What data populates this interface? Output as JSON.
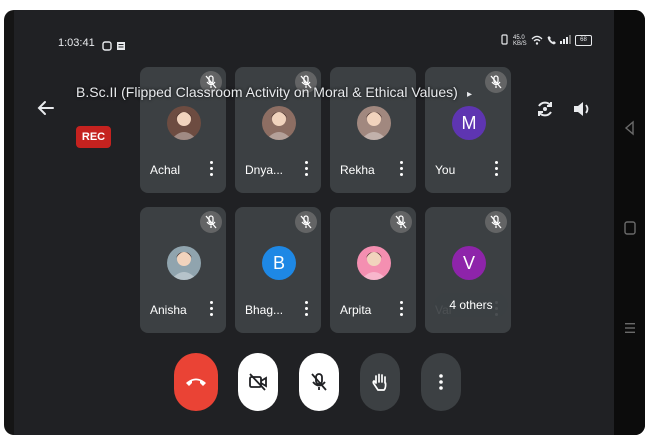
{
  "status_bar": {
    "time": "1:03:41",
    "network_speed": "45.0 KB/S",
    "battery": "68"
  },
  "meeting": {
    "title": "B.Sc.II (Flipped Classroom Activity on Moral & Ethical Values)",
    "rec_label": "REC",
    "others_label": "4 others"
  },
  "participants": [
    {
      "name": "Achal",
      "avatar": "photo",
      "color": "#6d4c41",
      "muted": true
    },
    {
      "name": "Dnya...",
      "avatar": "photo",
      "color": "#8d6e63",
      "muted": true
    },
    {
      "name": "Rekha",
      "avatar": "photo",
      "color": "#a1887f",
      "muted": false
    },
    {
      "name": "You",
      "avatar": "M",
      "color": "#5e35b1",
      "muted": true
    },
    {
      "name": "Anisha",
      "avatar": "photo",
      "color": "#90a4ae",
      "muted": true
    },
    {
      "name": "Bhag...",
      "avatar": "B",
      "color": "#1e88e5",
      "muted": true
    },
    {
      "name": "Arpita",
      "avatar": "photo",
      "color": "#f48fb1",
      "muted": true
    },
    {
      "name": "Vai",
      "avatar": "V",
      "color": "#8e24aa",
      "muted": true
    }
  ],
  "colors": {
    "end_call": "#ea4335",
    "tile_bg": "#3c4043",
    "rec": "#c5221f"
  }
}
